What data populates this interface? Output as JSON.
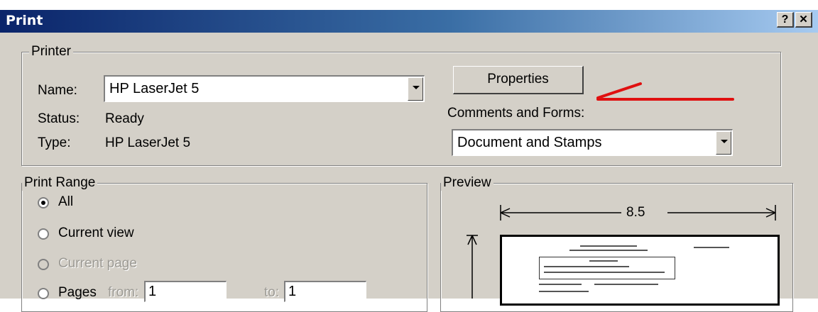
{
  "window": {
    "title": "Print",
    "help_button": "?",
    "close_button": "✕"
  },
  "printer": {
    "legend": "Printer",
    "name_label": "Name:",
    "name_value": "HP LaserJet 5",
    "status_label": "Status:",
    "status_value": "Ready",
    "type_label": "Type:",
    "type_value": "HP LaserJet 5",
    "properties_button": "Properties",
    "comments_label": "Comments and Forms:",
    "comments_value": "Document and Stamps"
  },
  "print_range": {
    "legend": "Print Range",
    "options": [
      {
        "label": "All",
        "checked": true,
        "enabled": true
      },
      {
        "label": "Current view",
        "checked": false,
        "enabled": true
      },
      {
        "label": "Current page",
        "checked": false,
        "enabled": false
      },
      {
        "label": "Pages",
        "checked": false,
        "enabled": true
      }
    ],
    "from_label": "from:",
    "from_value": "1",
    "to_label": "to:",
    "to_value": "1"
  },
  "preview": {
    "legend": "Preview",
    "width_value": "8.5"
  },
  "annotation": {
    "arrow_color": "#e01010"
  }
}
